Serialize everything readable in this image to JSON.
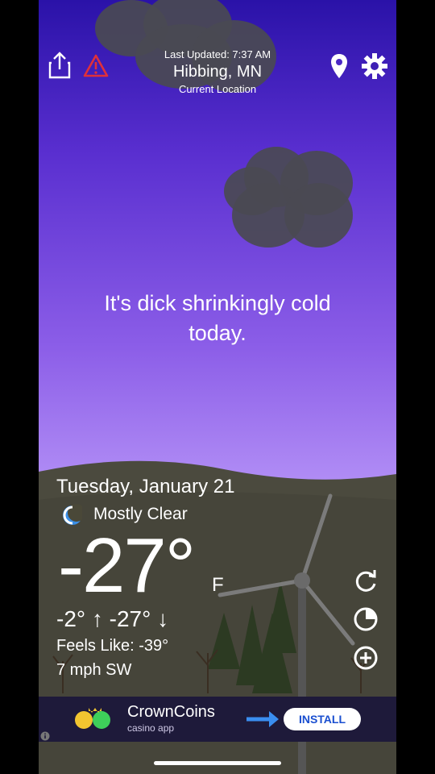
{
  "header": {
    "last_updated": "Last Updated: 7:37 AM",
    "city": "Hibbing, MN",
    "location_label": "Current Location"
  },
  "quote": "It's dick shrinkingly cold today.",
  "weather": {
    "date": "Tuesday, January 21",
    "condition": "Mostly Clear",
    "condition_icon": "moon-icon",
    "temperature": "-27°",
    "unit": "F",
    "hi_lo": "-2° ↑  -27° ↓",
    "feels_like": "Feels Like: -39°",
    "wind": "7 mph SW"
  },
  "ad": {
    "name": "CrownCoins",
    "subtitle": "casino app",
    "button": "INSTALL"
  },
  "colors": {
    "sky_top": "#2a12a8",
    "sky_bottom": "#c2a4ff",
    "cloud": "#4a4a52",
    "alert_red": "#e0303a"
  }
}
